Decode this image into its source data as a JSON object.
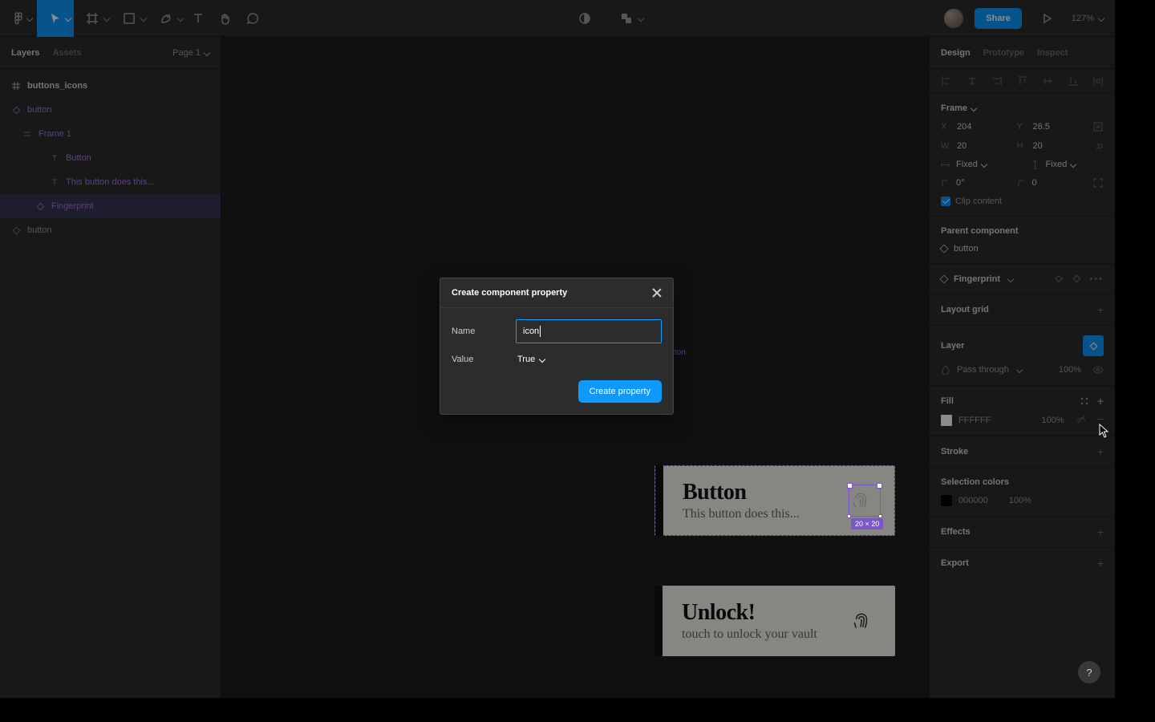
{
  "topbar": {
    "share_label": "Share",
    "zoom": "127%"
  },
  "left_panel": {
    "tabs": [
      "Layers",
      "Assets"
    ],
    "page_selector": "Page 1",
    "layers": [
      {
        "name": "buttons_icons",
        "icon": "component-set-icon",
        "purple": true,
        "bold": true,
        "indent": 0
      },
      {
        "name": "button",
        "icon": "component-icon",
        "purple": true,
        "indent": 0
      },
      {
        "name": "Frame 1",
        "icon": "frame-icon",
        "purple": true,
        "indent": 1
      },
      {
        "name": "Button",
        "icon": "text-icon",
        "purple": true,
        "indent": 2
      },
      {
        "name": "This button does this...",
        "icon": "text-icon",
        "purple": true,
        "indent": 2
      },
      {
        "name": "Fingerprint",
        "icon": "component-icon",
        "purple": true,
        "selected": true,
        "indent": 1
      },
      {
        "name": "button",
        "icon": "component-icon",
        "purple": false,
        "indent": 0
      }
    ]
  },
  "right_panel": {
    "tabs": [
      "Design",
      "Prototype",
      "Inspect"
    ],
    "frame": {
      "title": "Frame",
      "x_label": "X",
      "x": "204",
      "y_label": "Y",
      "y": "26.5",
      "w_label": "W",
      "w": "20",
      "h_label": "H",
      "h": "20",
      "width_mode": "Fixed",
      "height_mode": "Fixed",
      "rotation": "0°",
      "corner": "0",
      "clip_content": "Clip content"
    },
    "parent_component": {
      "title": "Parent component",
      "name": "button"
    },
    "instance": {
      "name": "Fingerprint"
    },
    "layout_grid": {
      "title": "Layout grid"
    },
    "layer": {
      "title": "Layer",
      "blend": "Pass through",
      "opacity": "100%"
    },
    "fill": {
      "title": "Fill",
      "hex": "FFFFFF",
      "opacity": "100%"
    },
    "stroke": {
      "title": "Stroke"
    },
    "selection_colors": {
      "title": "Selection colors",
      "hex": "000000",
      "opacity": "100%"
    },
    "effects": {
      "title": "Effects"
    },
    "export": {
      "title": "Export"
    }
  },
  "canvas": {
    "component_label": "button",
    "button1": {
      "title": "Button",
      "subtitle": "This button does this..."
    },
    "button2": {
      "title": "Unlock!",
      "subtitle": "touch to unlock your vault"
    },
    "selection_size": "20 × 20"
  },
  "modal": {
    "title": "Create component property",
    "name_label": "Name",
    "name_value": "icon",
    "value_label": "Value",
    "value_value": "True",
    "submit": "Create property"
  },
  "help": "?"
}
